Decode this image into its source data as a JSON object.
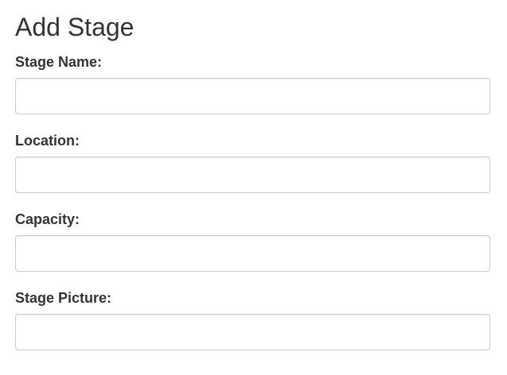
{
  "page": {
    "title": "Add Stage"
  },
  "form": {
    "fields": [
      {
        "label": "Stage Name:",
        "value": "",
        "placeholder": ""
      },
      {
        "label": "Location:",
        "value": "",
        "placeholder": ""
      },
      {
        "label": "Capacity:",
        "value": "",
        "placeholder": ""
      },
      {
        "label": "Stage Picture:",
        "value": "",
        "placeholder": ""
      }
    ]
  },
  "colors": {
    "text": "#333333",
    "input_border": "#cccccc",
    "background": "#ffffff"
  }
}
